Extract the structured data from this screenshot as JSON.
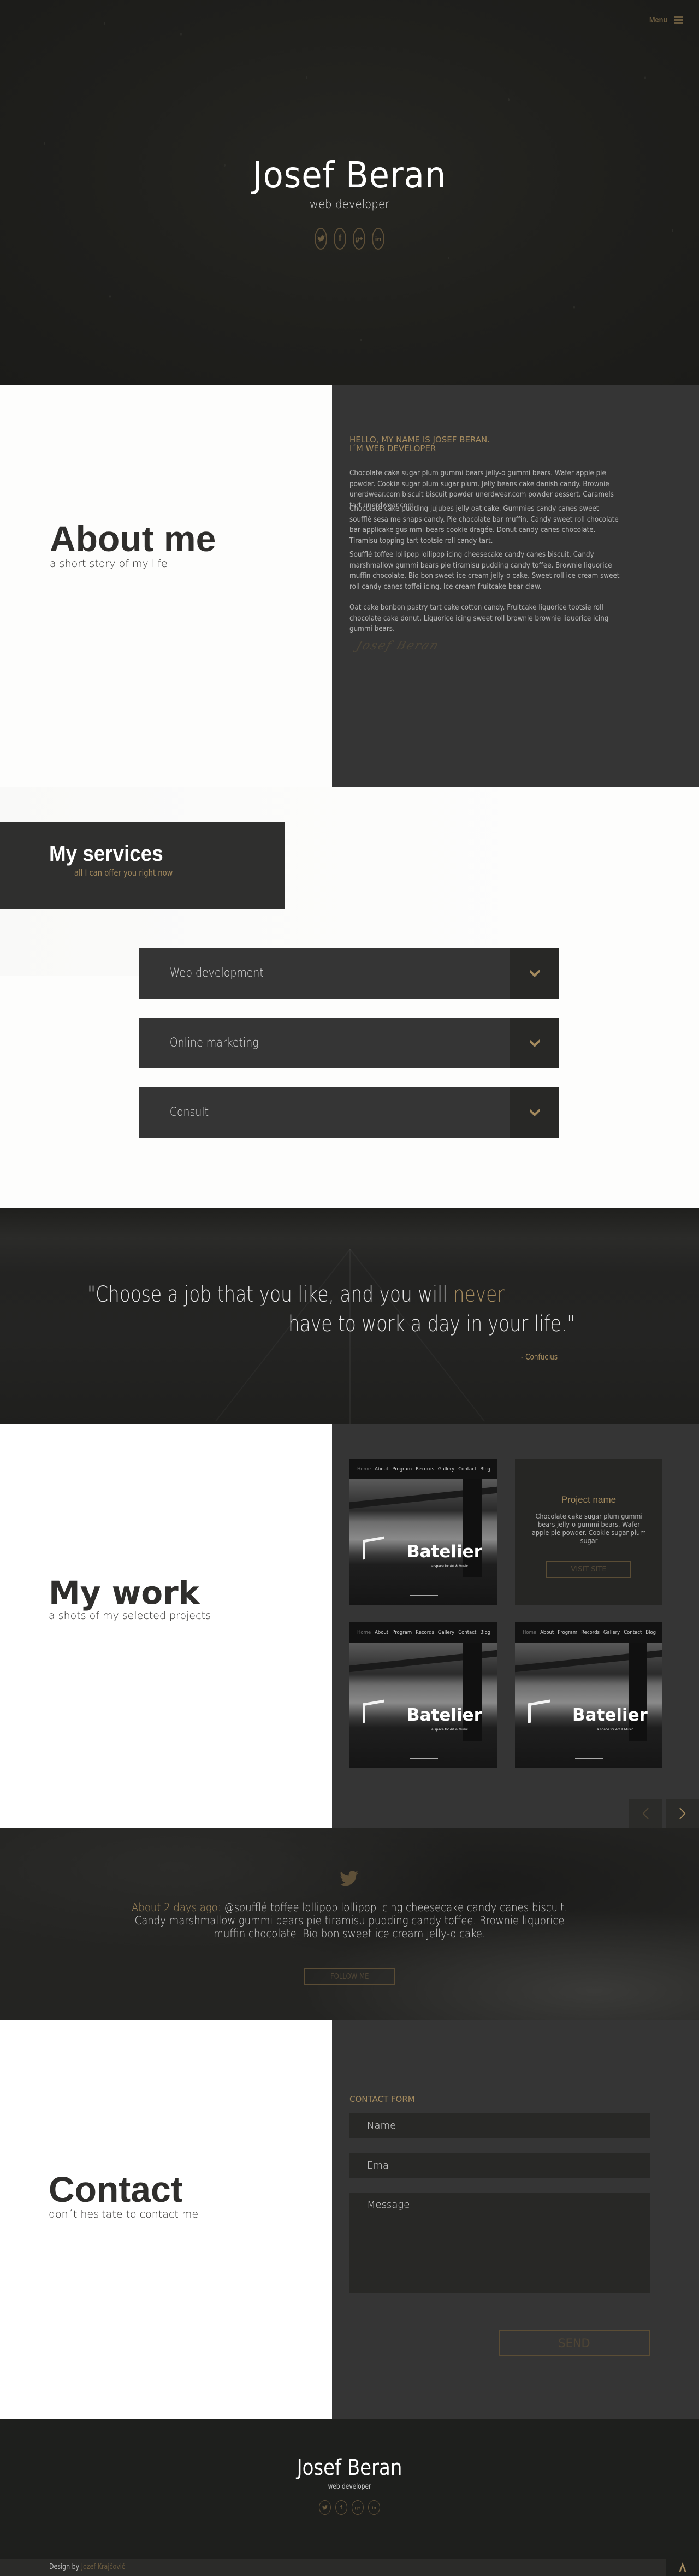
{
  "colors": {
    "accent": "#a58b5e",
    "dark_panel": "#353535",
    "hero_bg": "#1f1f1c",
    "light_bg": "#fdfdfc"
  },
  "nav": {
    "menu_label": "Menu",
    "menu_icon": "hamburger-icon"
  },
  "hero": {
    "title": "Josef Beran",
    "subtitle": "web developer",
    "socials": [
      {
        "name": "twitter",
        "glyph": "t"
      },
      {
        "name": "facebook",
        "glyph": "f"
      },
      {
        "name": "google-plus",
        "glyph": "g+"
      },
      {
        "name": "linkedin",
        "glyph": "in"
      }
    ]
  },
  "about": {
    "title": "About me",
    "subtitle": "a short story of my life",
    "hello_line1": "HELLO, MY NAME IS JOSEF BERAN.",
    "hello_line2": "I´M WEB DEVELOPER",
    "paragraphs": [
      "Chocolate cake sugar plum gummi bears jelly-o gummi bears. Wafer apple pie powder. Cookie sugar plum sugar plum. Jelly beans cake danish candy. Brownie unerdwear.com biscuit biscuit powder unerdwear.com powder dessert. Caramels tart unerdwear.com.",
      "Chocolate cake pudding jujubes jelly oat cake. Gummies candy canes sweet soufflé sesa me snaps candy. Pie chocolate bar muffin. Candy sweet roll chocolate bar applicake gus mmi bears cookie dragée. Donut candy canes chocolate. Tiramisu topping tart tootsie roll candy tart.",
      "Soufflé toffee lollipop lollipop icing cheesecake candy canes biscuit. Candy marshmallow gummi bears pie tiramisu pudding candy toffee. Brownie liquorice muffin chocolate. Bio bon sweet ice cream jelly-o cake. Sweet roll ice cream sweet roll candy canes toffei icing. Ice cream fruitcake bear claw.",
      "Oat cake bonbon pastry tart cake cotton candy. Fruitcake liquorice tootsie roll chocolate cake donut. Liquorice icing sweet roll brownie brownie liquorice icing gummi bears."
    ],
    "signature": "Josef Beran"
  },
  "services": {
    "title": "My services",
    "subtitle": "all I can offer you right now",
    "items": [
      {
        "label": "Web development",
        "expanded": false
      },
      {
        "label": "Online marketing",
        "expanded": false
      },
      {
        "label": "Consult",
        "expanded": false
      }
    ]
  },
  "quote": {
    "line1_before": "\"Choose a job that you like, and you will ",
    "line1_highlight": "never",
    "line2": "have to work a day in your life.\"",
    "author": "- Confucius"
  },
  "work": {
    "title": "My work",
    "subtitle": "a shots of my selected projects",
    "thumb_nav": [
      "Home",
      "About",
      "Program",
      "Records",
      "Gallery",
      "Contact",
      "Blog"
    ],
    "thumb_brand": "Batelier",
    "thumb_tagline": "a space for Art & Music",
    "project_card": {
      "name": "Project name",
      "description": "Chocolate cake sugar plum gummi bears jelly-o gummi bears. Wafer apple pie powder. Cookie sugar plum sugar",
      "button": "VISIT SITE"
    },
    "prev_icon": "chevron-left-icon",
    "next_icon": "chevron-right-icon"
  },
  "twitter": {
    "time_label": "About 2 days ago:",
    "tweet": " @soufflé toffee lollipop lollipop icing cheesecake candy canes biscuit. Candy marshmallow gummi bears pie tiramisu pudding candy toffee. Brownie liquorice muffin chocolate. Bio bon sweet ice cream jelly-o cake.",
    "follow_label": "FOLLOW ME"
  },
  "contact": {
    "title": "Contact",
    "subtitle": "don´t hesitate to contact me",
    "form_label": "CONTACT FORM",
    "name_placeholder": "Name",
    "name_value": "",
    "email_placeholder": "Email",
    "email_value": "",
    "message_placeholder": "Message",
    "message_value": "",
    "send_label": "SEND"
  },
  "footer": {
    "title": "Josef Beran",
    "subtitle": "web developer",
    "credit_prefix": "Design by ",
    "credit_author": "Jozef Krajčovič",
    "to_top_icon": "chevron-up-icon"
  }
}
